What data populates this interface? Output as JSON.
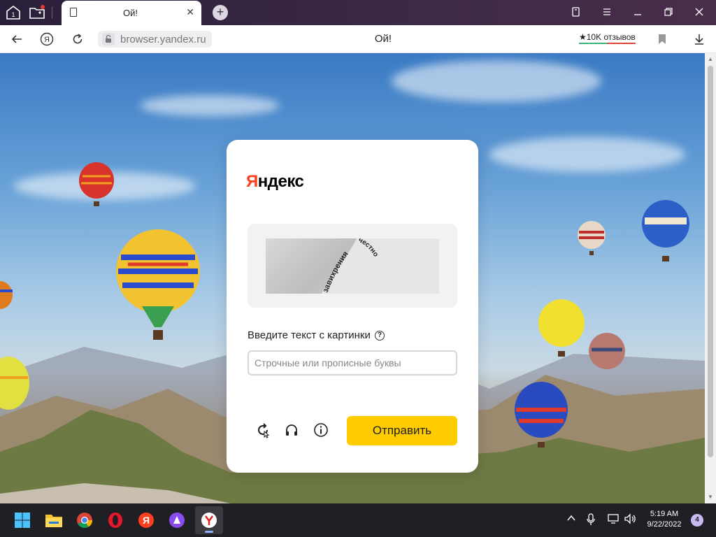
{
  "browser": {
    "tab_title": "Ой!",
    "tab_close": "✕",
    "new_tab": "+",
    "url": "browser.yandex.ru",
    "page_title": "Ой!",
    "reviews": "★10K отзывов"
  },
  "card": {
    "logo_first": "Я",
    "logo_rest": "ндекс",
    "captcha_words": [
      "завихрения",
      "честно"
    ],
    "prompt": "Введите текст с картинки",
    "help_symbol": "?",
    "input_placeholder": "Строчные или прописные буквы",
    "submit_label": "Отправить"
  },
  "taskbar": {
    "time": "5:19 AM",
    "date": "9/22/2022",
    "notifications": "4"
  },
  "colors": {
    "yandex_red": "#fc3f1d",
    "submit_yellow": "#ffcc00",
    "taskbar_bg": "#202024"
  }
}
